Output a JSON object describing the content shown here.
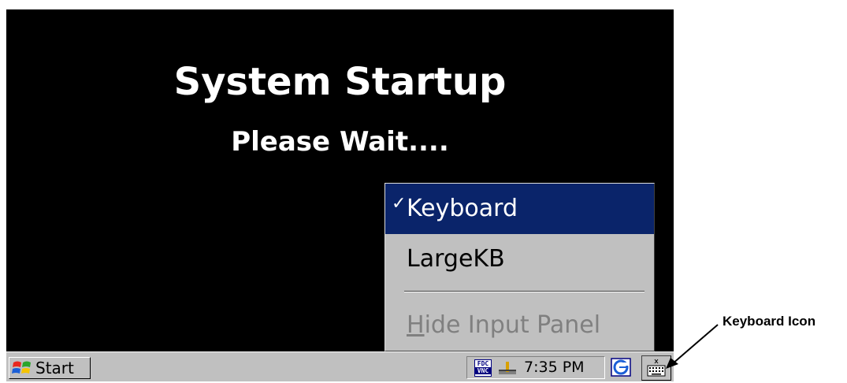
{
  "screen": {
    "title": "System Startup",
    "subtitle": "Please Wait...."
  },
  "input_menu": {
    "items": [
      {
        "label": "Keyboard",
        "checked": true,
        "selected": true,
        "enabled": true
      },
      {
        "label": "LargeKB",
        "checked": false,
        "selected": false,
        "enabled": true
      },
      {
        "label": "Hide Input Panel",
        "accel_char": "H",
        "rest": "ide Input Panel",
        "checked": false,
        "selected": false,
        "enabled": false
      }
    ],
    "check_glyph": "✓"
  },
  "taskbar": {
    "start_label": "Start",
    "fdc_label_top": "FDC",
    "fdc_label_bottom": "VNC",
    "clock": "7:35 PM"
  },
  "annotation": {
    "label": "Keyboard Icon"
  },
  "colors": {
    "screen_bg": "#000000",
    "menu_bg": "#c0c0c0",
    "highlight": "#0a246a",
    "disabled_text": "#808080"
  }
}
